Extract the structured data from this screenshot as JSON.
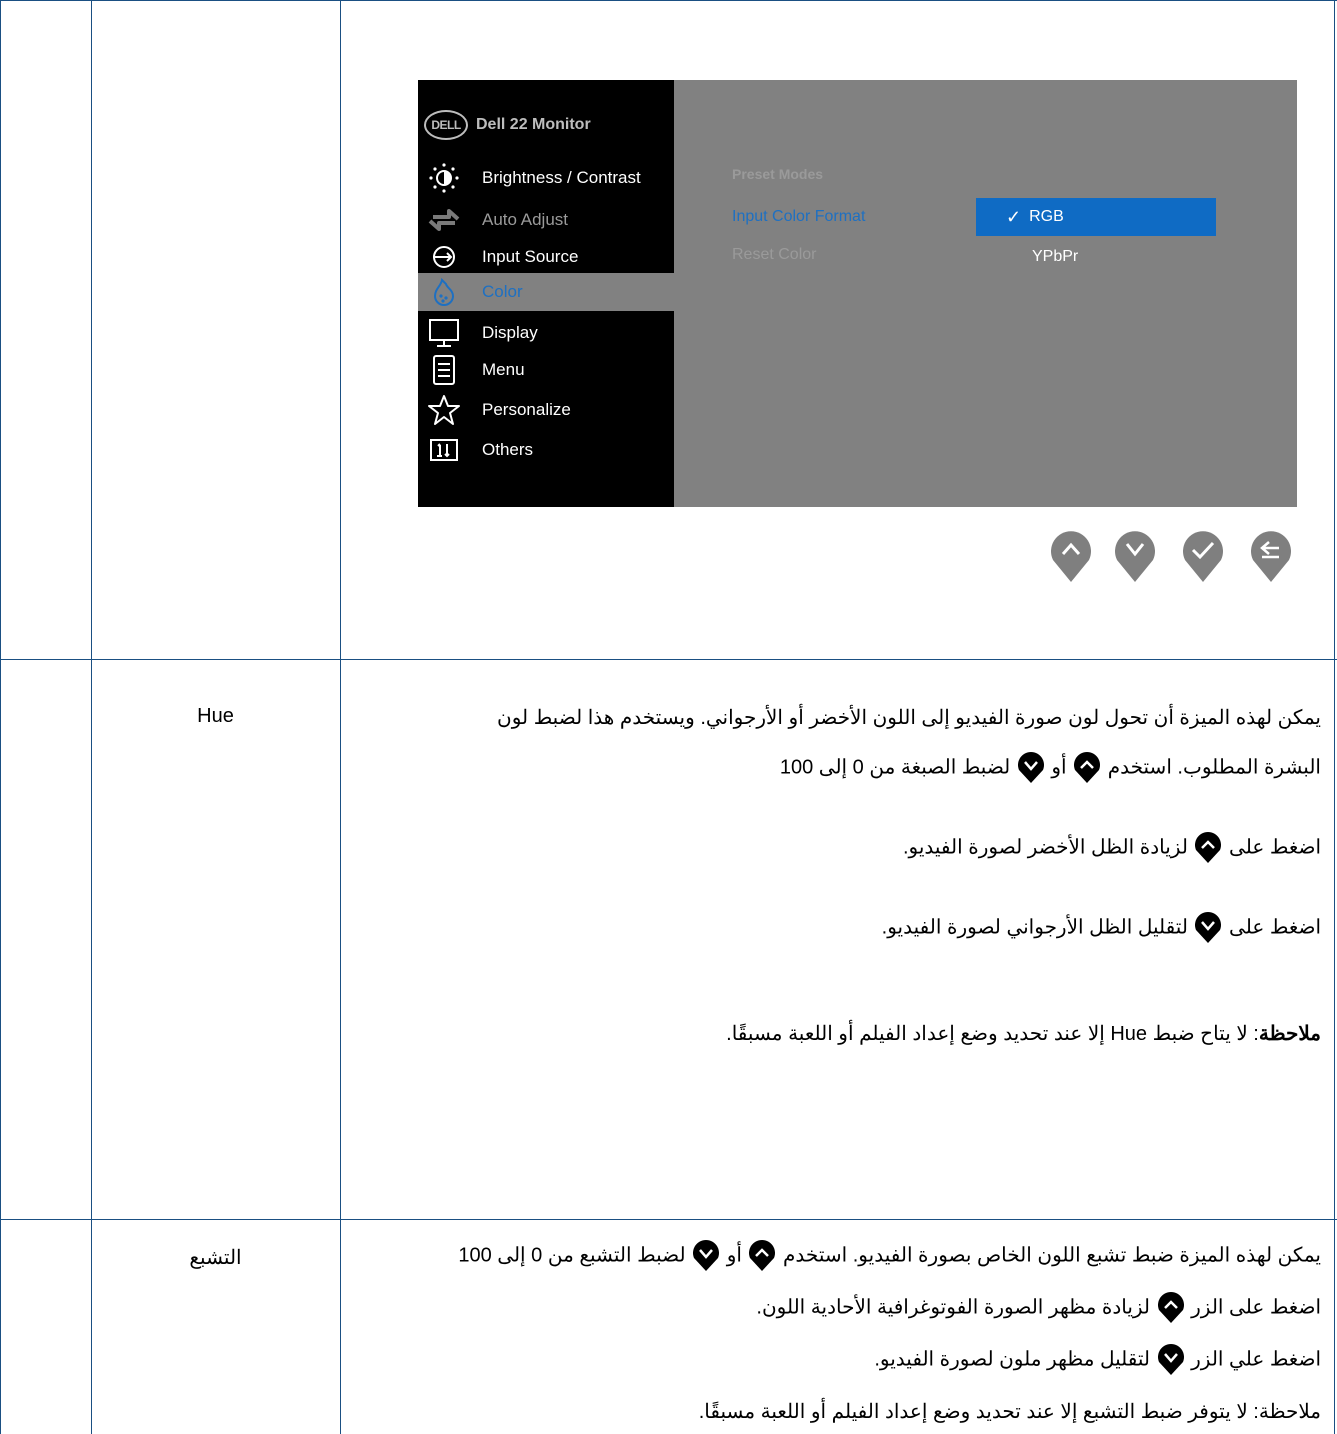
{
  "osd": {
    "title": "Dell 22 Monitor",
    "logo": "DELL",
    "menu": [
      {
        "label": "Brightness / Contrast",
        "icon": "brightness-icon",
        "state": "normal"
      },
      {
        "label": "Auto Adjust",
        "icon": "auto-adjust-icon",
        "state": "dim"
      },
      {
        "label": "Input Source",
        "icon": "input-source-icon",
        "state": "normal"
      },
      {
        "label": "Color",
        "icon": "color-icon",
        "state": "selected"
      },
      {
        "label": "Display",
        "icon": "display-icon",
        "state": "normal"
      },
      {
        "label": "Menu",
        "icon": "menu-icon",
        "state": "normal"
      },
      {
        "label": "Personalize",
        "icon": "star-icon",
        "state": "normal"
      },
      {
        "label": "Others",
        "icon": "others-icon",
        "state": "normal"
      }
    ],
    "submenu": {
      "preset_modes": "Preset Modes",
      "input_color_format": "Input Color Format",
      "reset_color": "Reset Color"
    },
    "options": {
      "selected": "RGB",
      "other": "YPbPr"
    },
    "nav_buttons": [
      "up-button",
      "down-button",
      "ok-button",
      "back-button"
    ],
    "colors": {
      "osd_bg": "#818181",
      "highlight": "#0f6bc4",
      "accent": "#1e70c2"
    }
  },
  "hue": {
    "label": "Hue",
    "line1": "يمكن لهذه الميزة أن تحول لون صورة الفيديو إلى اللون الأخضر أو الأرجواني. ويستخدم هذا لضبط لون",
    "line2_a": "البشرة المطلوب. استخدم",
    "line2_b": "أو",
    "line2_c": "لضبط الصبغة من 0 إلى 100",
    "line3_a": "اضغط على",
    "line3_b": "لزيادة الظل الأخضر لصورة الفيديو.",
    "line4_a": "اضغط على",
    "line4_b": "لتقليل الظل الأرجواني لصورة الفيديو.",
    "note_label": "ملاحظة",
    "note_text": ": لا يتاح ضبط Hue إلا عند تحديد وضع إعداد الفيلم أو اللعبة مسبقًا."
  },
  "saturation": {
    "label": "التشبع",
    "line1_a": "يمكن لهذه الميزة ضبط تشبع اللون الخاص بصورة الفيديو. استخدم",
    "line1_b": "أو",
    "line1_c": "لضبط التشبع من 0 إلى 100",
    "line2_a": "اضغط على الزر",
    "line2_b": "لزيادة مظهر الصورة الفوتوغرافية الأحادية اللون.",
    "line3_a": "اضغط علي الزر",
    "line3_b": "لتقليل مظهر ملون لصورة الفيديو.",
    "note": "ملاحظة: لا يتوفر ضبط التشبع إلا عند تحديد وضع إعداد الفيلم أو اللعبة مسبقًا."
  }
}
